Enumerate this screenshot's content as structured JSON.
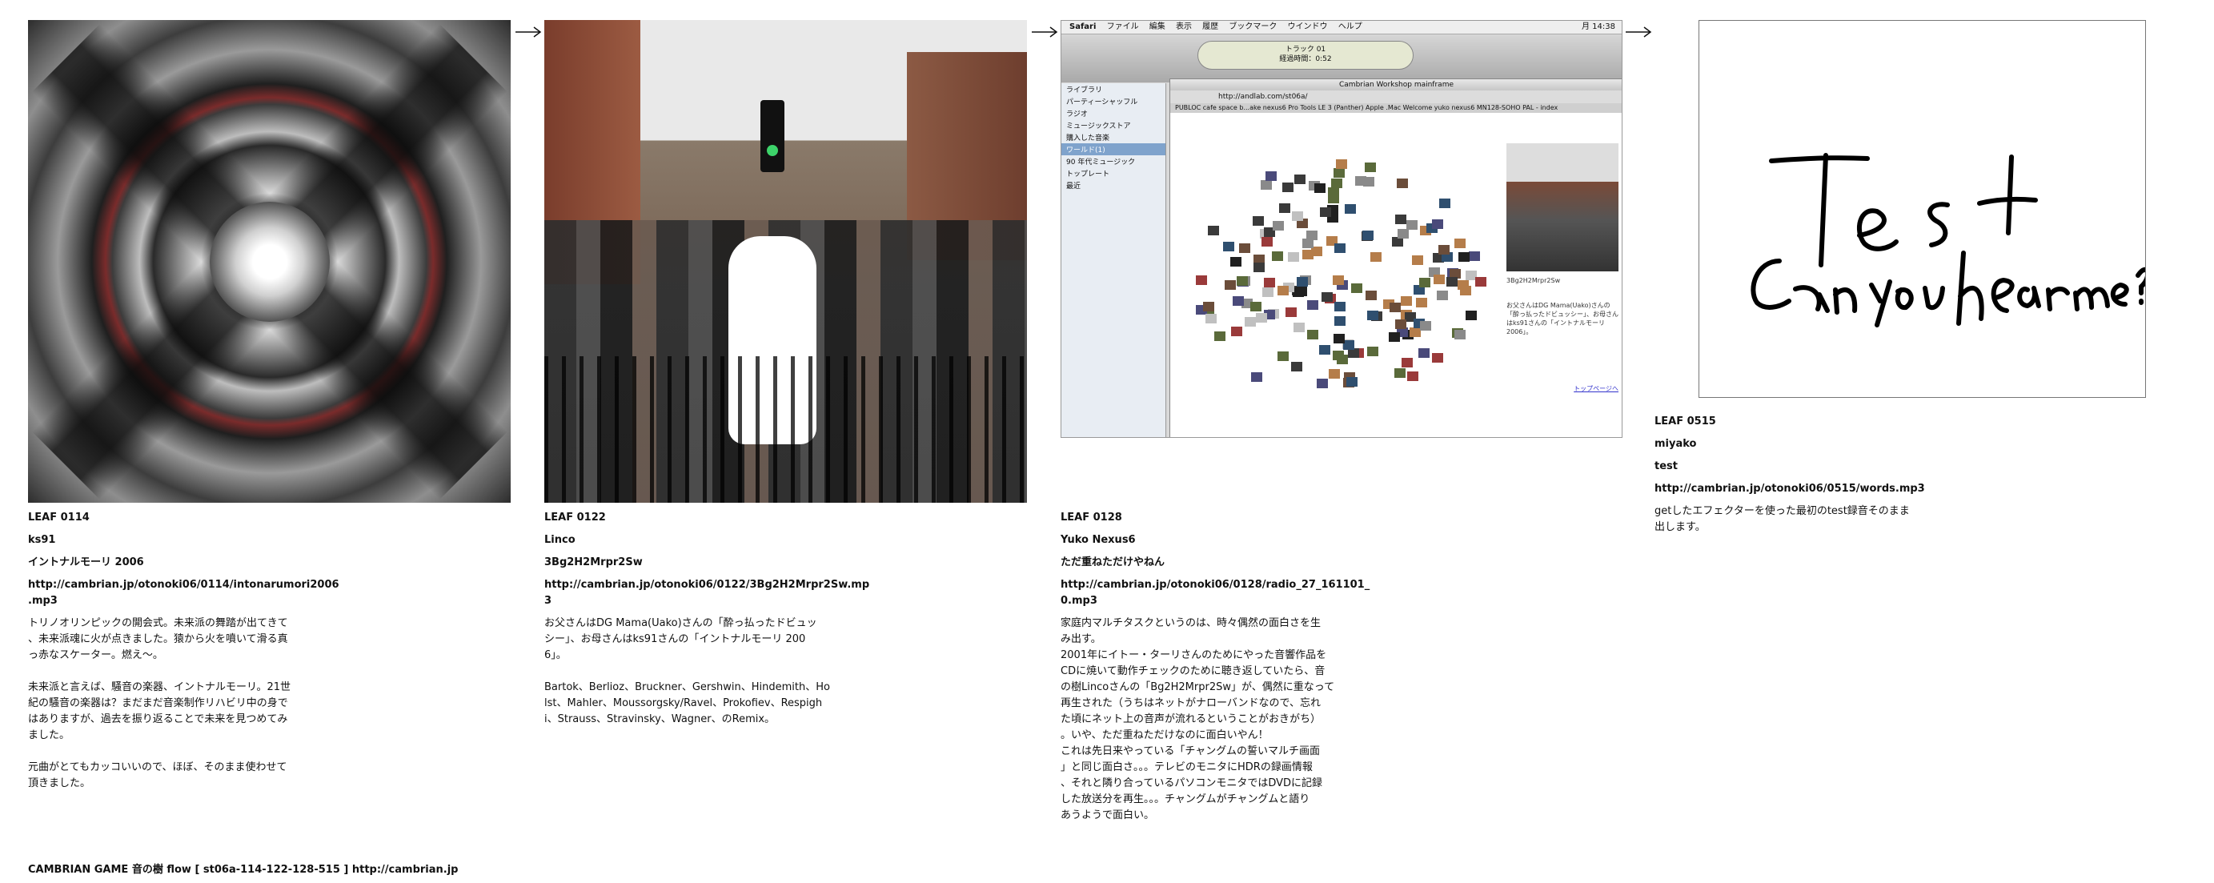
{
  "leaves": [
    {
      "id": "LEAF 0114",
      "author": "ks91",
      "title": "イントナルモーリ 2006",
      "url": "http://cambrian.jp/otonoki06/0114/intonarumori2006\n.mp3",
      "paragraphs": [
        "トリノオリンピックの開会式。未来派の舞踏が出てきて\n、未来派魂に火が点きました。猿から火を噴いて滑る真\nっ赤なスケーター。燃え～。",
        "未来派と言えば、騒音の楽器、イントナルモーリ。21世\n紀の騒音の楽器は？まだまだ音楽制作リハビリ中の身で\nはありますが、過去を振り返ることで未来を見つめてみ\nました。",
        "元曲がとてもカッコいいので、ほぼ、そのまま使わせて\n頂きました。"
      ],
      "image_desc": "tunnel-image"
    },
    {
      "id": "LEAF 0122",
      "author": "Linco",
      "title": "3Bg2H2Mrpr2Sw",
      "url": "http://cambrian.jp/otonoki06/0122/3Bg2H2Mrpr2Sw.mp\n3",
      "paragraphs": [
        "お父さんはDG Mama(Uako)さんの「酔っ払ったドビュッ\nシー」、お母さんはks91さんの「イントナルモーリ 200\n6」。",
        "Bartok、Berlioz、Bruckner、Gershwin、Hindemith、Ho\nlst、Mahler、Moussorgsky/Ravel、Prokofiev、Respigh\ni、Strauss、Stravinsky、Wagner、のRemix。"
      ],
      "image_desc": "street-image"
    },
    {
      "id": "LEAF 0128",
      "author": "Yuko Nexus6",
      "title": "ただ重ねただけやねん",
      "url": "http://cambrian.jp/otonoki06/0128/radio_27_161101_\n0.mp3",
      "paragraphs": [
        "家庭内マルチタスクというのは、時々偶然の面白さを生\nみ出す。\n2001年にイトー・ターリさんのためにやった音響作品を\nCDに焼いて動作チェックのために聴き返していたら、音\nの樹Lincoさんの「Bg2H2Mrpr2Sw」が、偶然に重なって\n再生された（うちはネットがナローバンドなので、忘れ\nた頃にネット上の音声が流れるということがおきがち）\n。いや、ただ重ねただけなのに面白いやん！\nこれは先日来やっている「チャングムの誓いマルチ画面\n」と同じ面白さ。。。テレビのモニタにHDRの録画情報\n、それと隣り合っているパソコンモニタではDVDに記録\nした放送分を再生。。。チャングムがチャングムと語り\nあうようで面白い。"
      ],
      "image_desc": "screenshot-image"
    },
    {
      "id": "LEAF 0515",
      "author": "miyako",
      "title": "test",
      "url": "http://cambrian.jp/otonoki06/0515/words.mp3",
      "paragraphs": [
        "getしたエフェクターを使った最初のtest録音そのまま\n出します。"
      ],
      "image_desc": "handwriting-image"
    }
  ],
  "screenshot": {
    "menu": [
      "Safari",
      "ファイル",
      "編集",
      "表示",
      "履歴",
      "ブックマーク",
      "ウインドウ",
      "ヘルプ"
    ],
    "clock": "月 14:38",
    "lcd_line1": "トラック 01",
    "lcd_line2": "経過時間：0:52",
    "browser_title": "Cambrian Workshop mainframe",
    "browser_url": "http://andlab.com/st06a/",
    "bookmarks": "PUBLOC  cafe space b...ake nexus6  Pro Tools LE  3 (Panther)  Apple .Mac Welcome  yuko nexus6  MN128-SOHO PAL - index",
    "sidebar": [
      "ライブラリ",
      "パーティーシャッフル",
      "ラジオ",
      "ミュージックストア",
      "購入した音楽",
      "ワールド(1)",
      "90 年代ミュージック",
      "トップレート",
      "最近"
    ],
    "right_label": "3Bg2H2Mrpr2Sw",
    "right_text": "お父さんはDG Mama(Uako)さんの「酔っ払ったドビュッシー」、お母さんはks91さんの「イントナルモーリ 2006」。",
    "right_link": "トップページへ"
  },
  "handwriting": {
    "line1": "Test",
    "line2": "Can you hear me?"
  },
  "footer": "CAMBRIAN GAME  音の樹  flow [ st06a-114-122-128-515 ]    http://cambrian.jp",
  "arrow_icon": "right-arrow-icon"
}
